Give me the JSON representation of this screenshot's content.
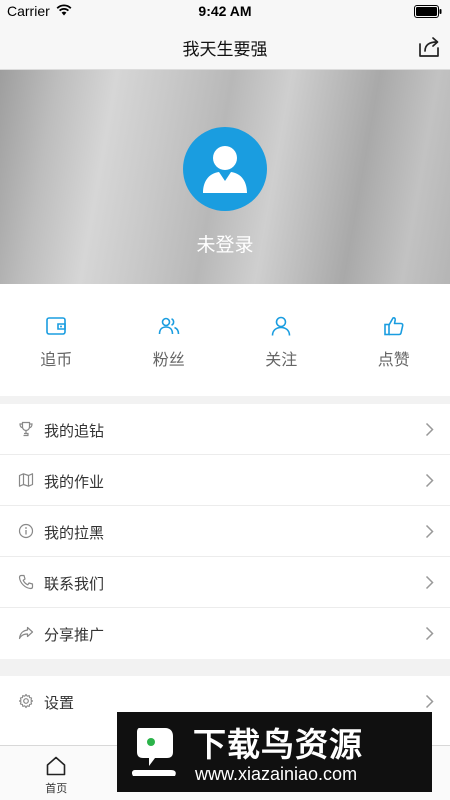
{
  "status_bar": {
    "carrier": "Carrier",
    "time": "9:42 AM"
  },
  "nav": {
    "title": "我天生要强"
  },
  "profile": {
    "login_status": "未登录"
  },
  "stats": [
    {
      "label": "追币",
      "icon": "wallet-icon"
    },
    {
      "label": "粉丝",
      "icon": "fans-icon"
    },
    {
      "label": "关注",
      "icon": "person-icon"
    },
    {
      "label": "点赞",
      "icon": "thumbs-up-icon"
    }
  ],
  "menu": [
    {
      "label": "我的追钻",
      "icon": "trophy-icon"
    },
    {
      "label": "我的作业",
      "icon": "map-icon"
    },
    {
      "label": "我的拉黑",
      "icon": "info-icon"
    },
    {
      "label": "联系我们",
      "icon": "phone-icon"
    },
    {
      "label": "分享推广",
      "icon": "share-arrow-icon"
    }
  ],
  "settings": {
    "label": "设置",
    "icon": "gear-icon"
  },
  "tabs": [
    {
      "label": "首页",
      "icon": "home-icon"
    }
  ],
  "watermark": {
    "title": "下载鸟资源",
    "url": "www.xiazainiao.com"
  },
  "colors": {
    "accent": "#1a9de0",
    "background": "#f2f2f2",
    "nav_bg": "#f7f7f7"
  }
}
